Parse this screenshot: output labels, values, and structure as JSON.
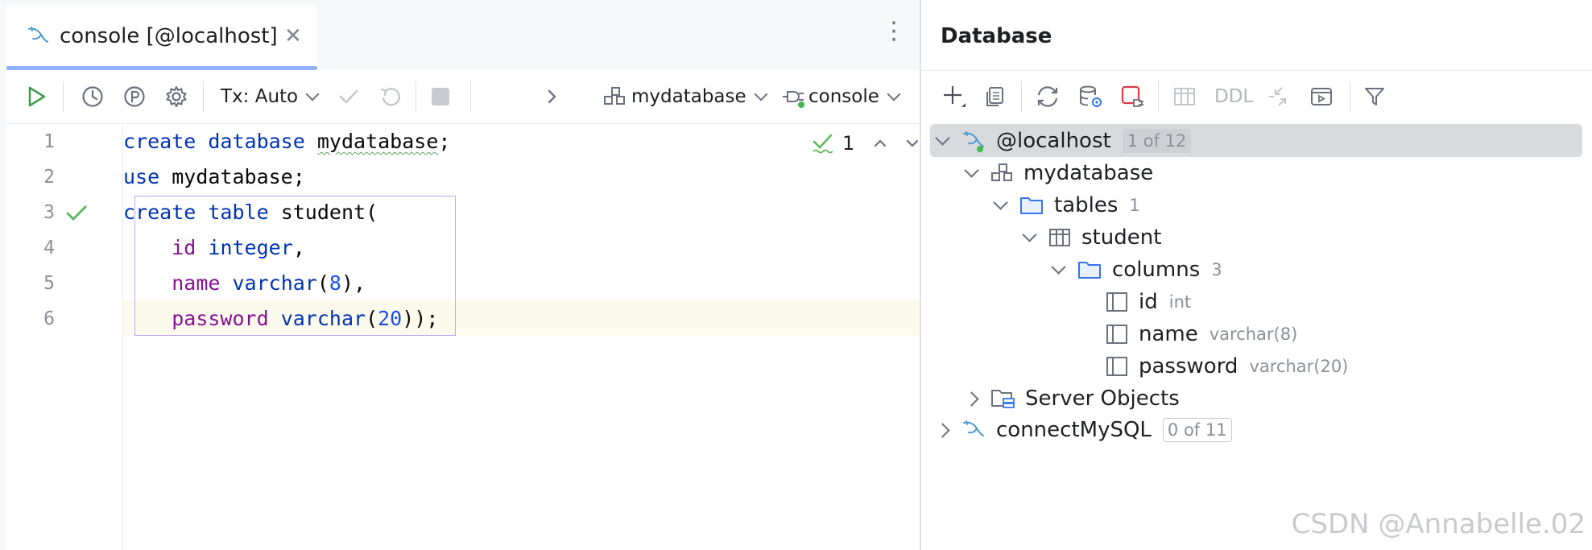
{
  "editor": {
    "tab": {
      "label": "console [@localhost]",
      "icon": "mysql-dolphin-icon"
    },
    "toolbar": {
      "tx_label": "Tx: Auto",
      "schema": "mydatabase",
      "session": "console"
    },
    "lines": [
      {
        "num": "1"
      },
      {
        "num": "2"
      },
      {
        "num": "3"
      },
      {
        "num": "4"
      },
      {
        "num": "5"
      },
      {
        "num": "6"
      }
    ],
    "code": {
      "l1": {
        "create": "create",
        "database": "database",
        "name": "mydatabase",
        "semi": ";"
      },
      "l2": {
        "use": "use",
        "name": "mydatabase",
        "semi": ";"
      },
      "l3": {
        "create": "create",
        "table": "table",
        "name": "student",
        "paren": "("
      },
      "l4": {
        "col": "id",
        "type": "integer",
        "comma": ","
      },
      "l5": {
        "col": "name",
        "type": "varchar",
        "open": "(",
        "len": "8",
        "close": ")",
        "comma": ","
      },
      "l6": {
        "col": "password",
        "type": "varchar",
        "open": "(",
        "len": "20",
        "close": "))",
        "semi": ";"
      }
    },
    "inspection_count": "1"
  },
  "database": {
    "title": "Database",
    "toolbar": {
      "ddl_label": "DDL"
    },
    "tree": {
      "localhost": {
        "label": "@localhost",
        "badge": "1 of 12"
      },
      "mydatabase": {
        "label": "mydatabase"
      },
      "tables": {
        "label": "tables",
        "count": "1"
      },
      "student": {
        "label": "student"
      },
      "columns": {
        "label": "columns",
        "count": "3"
      },
      "col_id": {
        "label": "id",
        "type": "int"
      },
      "col_name": {
        "label": "name",
        "type": "varchar(8)"
      },
      "col_password": {
        "label": "password",
        "type": "varchar(20)"
      },
      "server_objects": {
        "label": "Server Objects"
      },
      "connect": {
        "label": "connectMySQL",
        "badge": "0 of 11"
      }
    }
  },
  "watermark": "CSDN @Annabelle.02",
  "colors": {
    "keyword": "#0033b3",
    "identifier": "#871094",
    "number": "#1750eb",
    "accent": "#3574f0",
    "success": "#5fb85f",
    "selection": "#d9dadd"
  }
}
